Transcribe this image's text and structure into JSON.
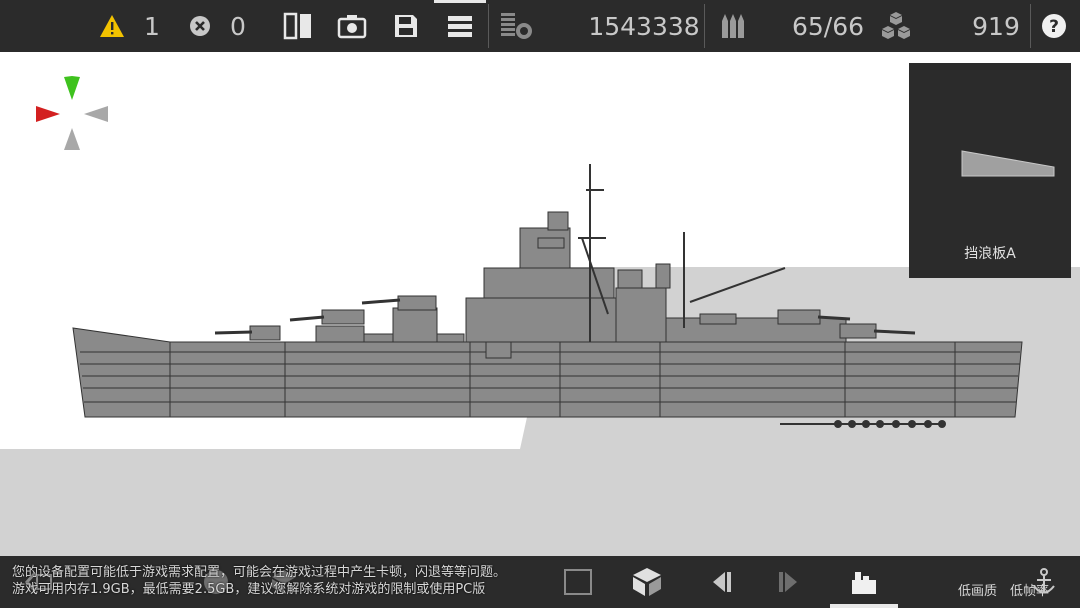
{
  "topbar": {
    "warnings": "1",
    "errors": "0",
    "cost": "1543338",
    "ammo": "65/66",
    "parts": "919"
  },
  "preview": {
    "part_name": "挡浪板A"
  },
  "bottombar": {
    "notice_line1": "您的设备配置可能低于游戏需求配置，可能会在游戏过程中产生卡顿，闪退等等问题。",
    "notice_line2": "游戏可用内存1.9GB，最低需要2.5GB，建议您解除系统对游戏的限制或使用PC版",
    "quality_label": "低画质",
    "frame_label": "低帧率"
  },
  "colors": {
    "bar_bg": "#2b2b2b",
    "warning": "#f2c200",
    "ship_hull": "#8a8a8a",
    "compass_red": "#d32020",
    "compass_green": "#3fc21e"
  }
}
